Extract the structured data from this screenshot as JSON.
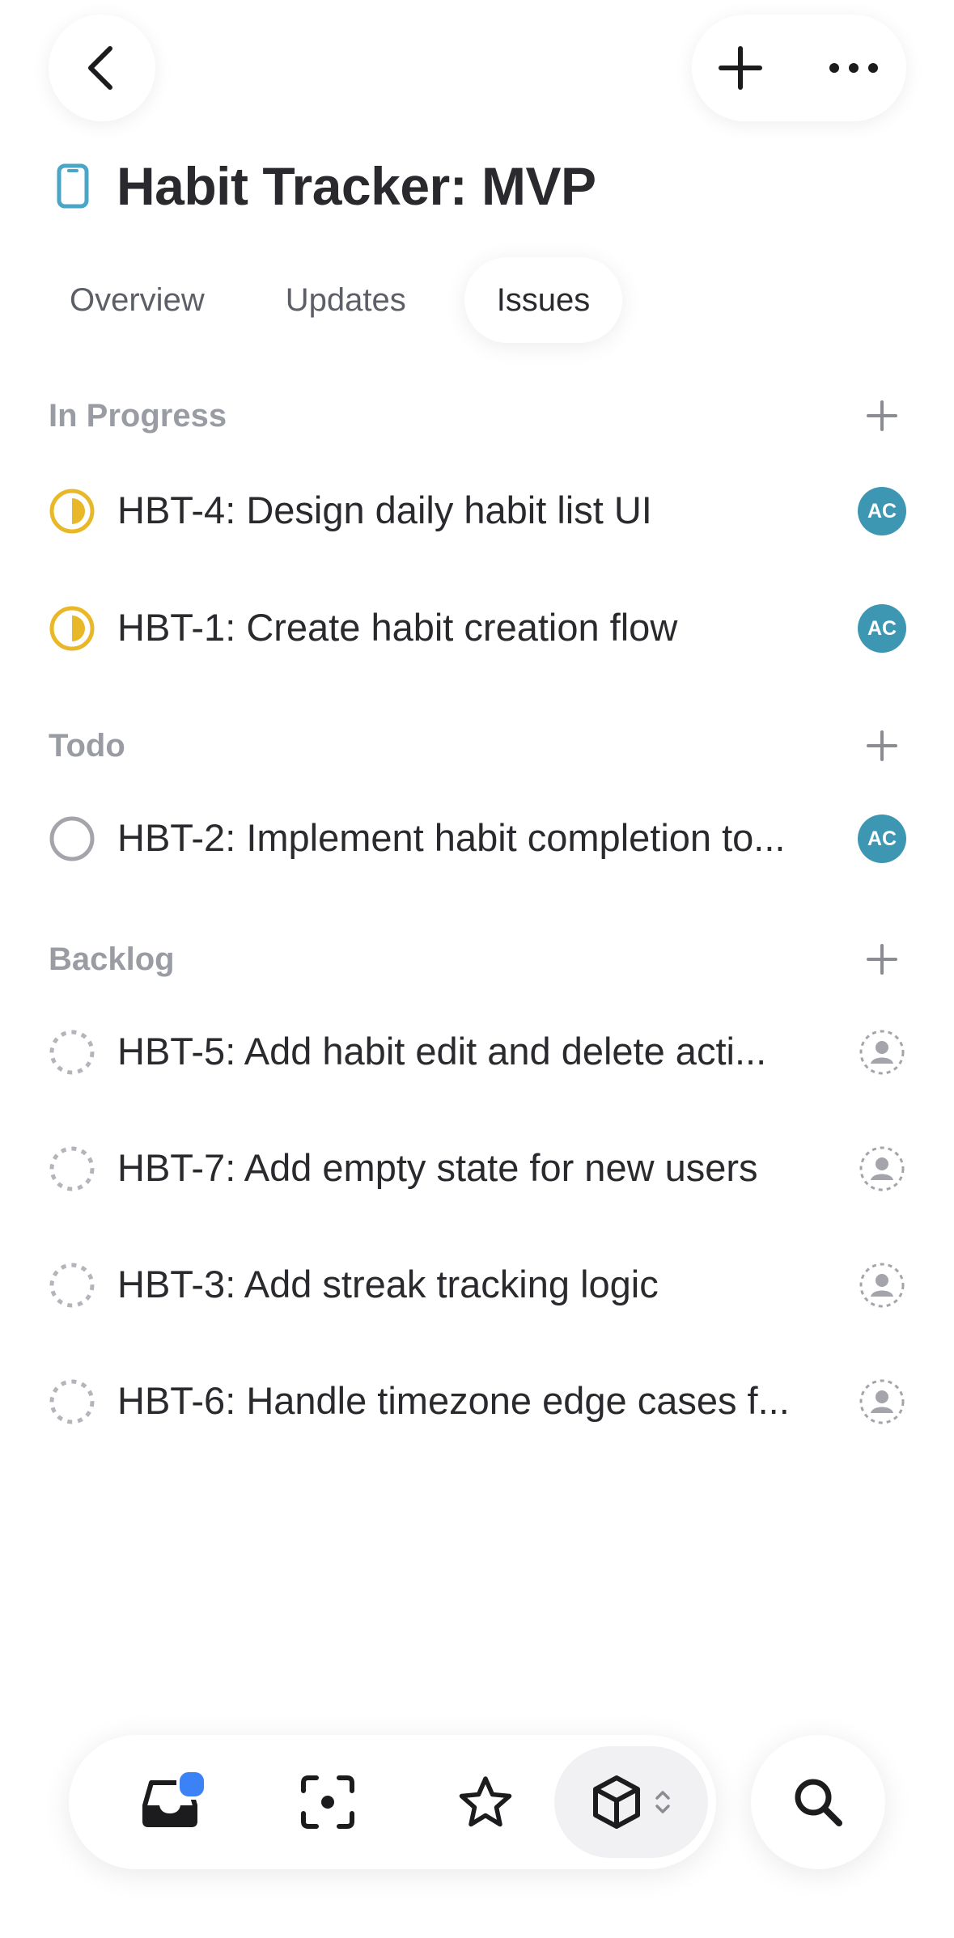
{
  "project": {
    "title": "Habit Tracker: MVP",
    "icon": "phone-device-icon"
  },
  "tabs": [
    {
      "label": "Overview",
      "active": false
    },
    {
      "label": "Updates",
      "active": false
    },
    {
      "label": "Issues",
      "active": true
    }
  ],
  "sections": [
    {
      "title": "In Progress",
      "issues": [
        {
          "text": "HBT-4: Design daily habit list UI",
          "assignee": "AC"
        },
        {
          "text": "HBT-1: Create habit creation flow",
          "assignee": "AC"
        }
      ]
    },
    {
      "title": "Todo",
      "issues": [
        {
          "text": "HBT-2: Implement habit completion to...",
          "assignee": "AC"
        }
      ]
    },
    {
      "title": "Backlog",
      "issues": [
        {
          "text": "HBT-5: Add habit edit and delete acti...",
          "assignee": ""
        },
        {
          "text": "HBT-7: Add empty state for new users",
          "assignee": ""
        },
        {
          "text": "HBT-3: Add streak tracking logic",
          "assignee": ""
        },
        {
          "text": "HBT-6: Handle timezone edge cases f...",
          "assignee": ""
        }
      ]
    }
  ],
  "colors": {
    "in_progress": "#e8b829",
    "todo": "#a3a5ab",
    "backlog": "#b3b5ba",
    "avatar": "#3d97b3",
    "badge": "#3b82f6",
    "project_icon": "#4aa6c7"
  },
  "nav": {
    "items": [
      "inbox-icon",
      "focus-icon",
      "star-icon",
      "cube-icon",
      "search-icon"
    ],
    "inbox_has_badge": true
  }
}
